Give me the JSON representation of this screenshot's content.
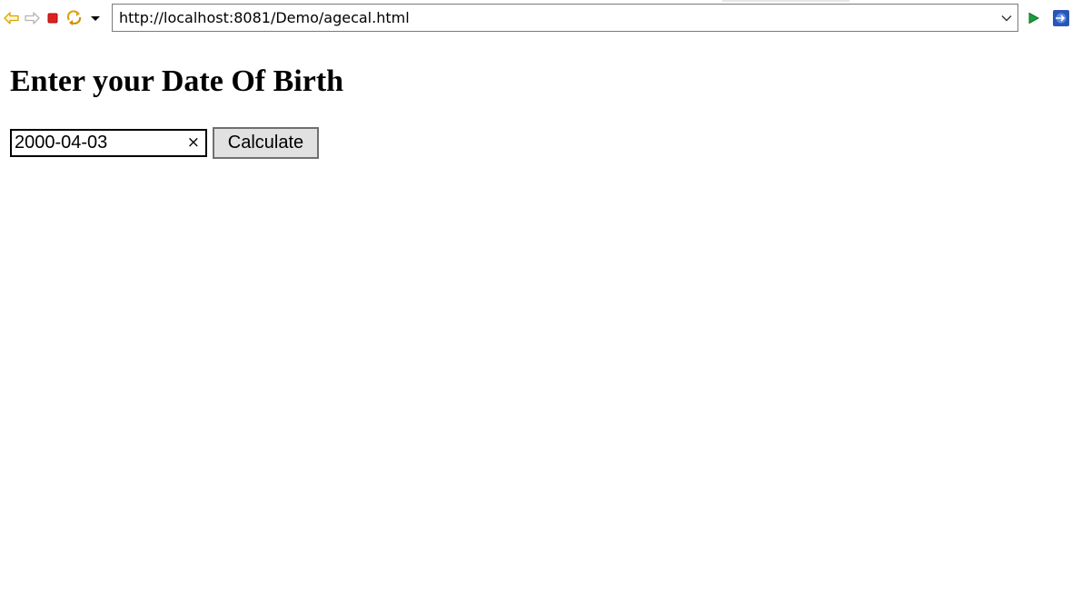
{
  "browser": {
    "address_url": "http://localhost:8081/Demo/agecal.html",
    "icons": {
      "back": "back-arrow-icon",
      "forward": "forward-arrow-icon",
      "stop": "stop-icon",
      "refresh": "refresh-icon",
      "menu": "dropdown-caret-icon",
      "url_dropdown": "chevron-down-icon",
      "go": "go-play-icon",
      "external": "open-external-browser-icon"
    },
    "colors": {
      "back_arrow": "#e8b400",
      "stop": "#e02020",
      "go": "#1a9f3a",
      "external": "#2a55b8"
    }
  },
  "page": {
    "title": "Enter your Date Of Birth",
    "dob_input": {
      "value": "2000-04-03",
      "clear_label": "×"
    },
    "calculate_label": "Calculate"
  }
}
